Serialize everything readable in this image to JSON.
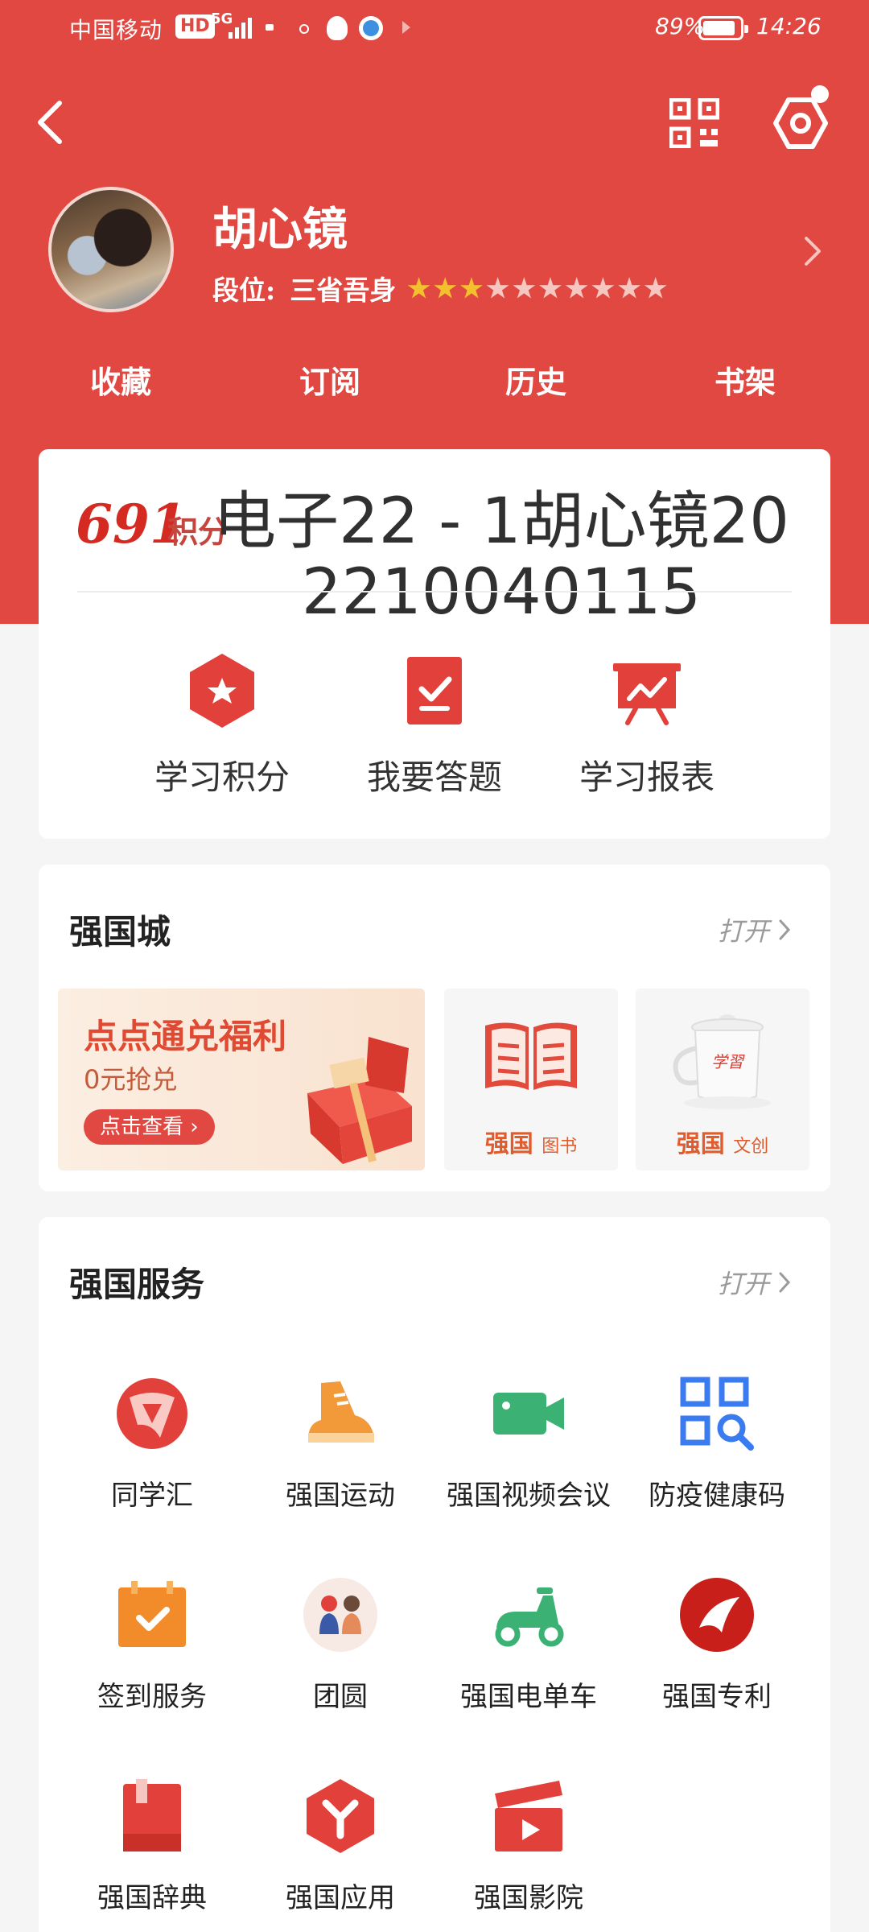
{
  "status_bar": {
    "carrier": "中国移动",
    "hd_tag": "HD",
    "network": "5G",
    "battery": "89%",
    "battery_level": 0.89,
    "time": "14:26"
  },
  "profile": {
    "name": "胡心镜",
    "rank_label": "段位:",
    "rank_value": "三省吾身",
    "stars_total": 10,
    "stars_on": 3
  },
  "quick_tabs": [
    "收藏",
    "订阅",
    "历史",
    "书架"
  ],
  "points": {
    "value": "691",
    "unit": "积分",
    "overlay_text": "电子22 - 1胡心镜20 2210040115"
  },
  "features": [
    {
      "label": "学习积分",
      "icon": "star-hexagon-icon"
    },
    {
      "label": "我要答题",
      "icon": "answer-check-icon"
    },
    {
      "label": "学习报表",
      "icon": "report-chart-icon"
    }
  ],
  "mall": {
    "title": "强国城",
    "open": "打开",
    "banner_title": "点点通兑福利",
    "banner_sub": "0元抢兑",
    "banner_button": "点击查看 ›",
    "tiles": [
      {
        "brand": "强国",
        "label": "图书"
      },
      {
        "brand": "强国",
        "label": "文创"
      }
    ],
    "cup_text": "学習"
  },
  "services": {
    "title": "强国服务",
    "open": "打开",
    "items": [
      {
        "label": "同学汇",
        "icon": "classmates-icon"
      },
      {
        "label": "强国运动",
        "icon": "sneaker-icon"
      },
      {
        "label": "强国视频会议",
        "icon": "video-camera-icon"
      },
      {
        "label": "防疫健康码",
        "icon": "health-qr-icon"
      },
      {
        "label": "签到服务",
        "icon": "checkin-calendar-icon"
      },
      {
        "label": "团圆",
        "icon": "reunion-icon"
      },
      {
        "label": "强国电单车",
        "icon": "scooter-icon"
      },
      {
        "label": "强国专利",
        "icon": "patent-icon"
      },
      {
        "label": "强国辞典",
        "icon": "dictionary-icon"
      },
      {
        "label": "强国应用",
        "icon": "apps-hexagon-icon"
      },
      {
        "label": "强国影院",
        "icon": "clapperboard-icon"
      }
    ]
  },
  "colors": {
    "brand_red": "#e04841",
    "star_on": "#f3c12d",
    "background": "#f5f5f5"
  }
}
